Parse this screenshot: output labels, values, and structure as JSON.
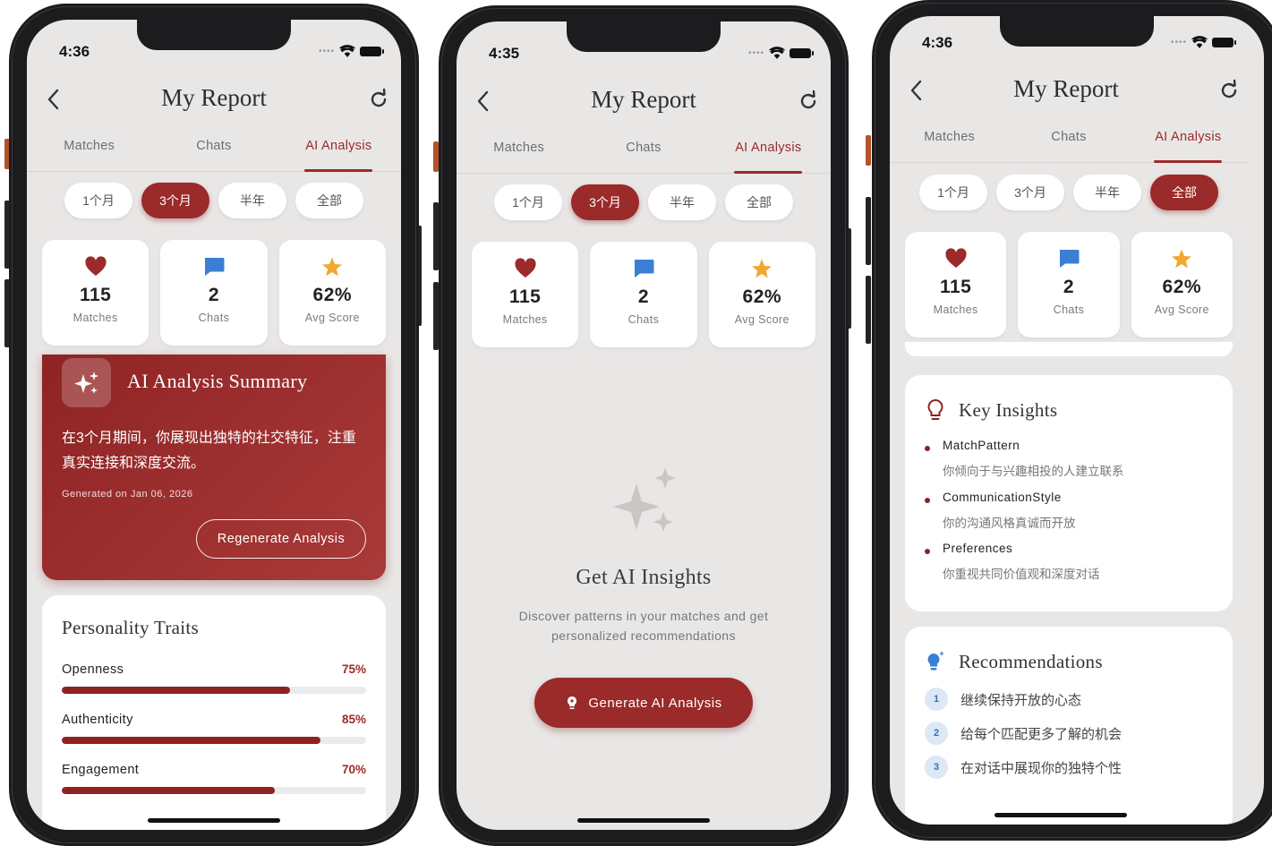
{
  "phones": [
    {
      "time": "4:36",
      "title": "My Report",
      "tabs": [
        "Matches",
        "Chats",
        "AI Analysis"
      ],
      "periods": [
        "1个月",
        "3个月",
        "半年",
        "全部"
      ],
      "stats": [
        {
          "value": "115",
          "label": "Matches",
          "icon": "heart-icon"
        },
        {
          "value": "2",
          "label": "Chats",
          "icon": "chat-bubble-icon"
        },
        {
          "value": "62%",
          "label": "Avg Score",
          "icon": "star-icon"
        }
      ],
      "summary": {
        "title": "AI Analysis Summary",
        "text": "在3个月期间，你展现出独特的社交特征，注重真实连接和深度交流。",
        "generated": "Generated on Jan 06, 2026",
        "button": "Regenerate Analysis"
      },
      "traits": {
        "title": "Personality Traits",
        "items": [
          {
            "name": "Openness",
            "percent": "75%",
            "value": 0.75
          },
          {
            "name": "Authenticity",
            "percent": "85%",
            "value": 0.85
          },
          {
            "name": "Engagement",
            "percent": "70%",
            "value": 0.7
          }
        ]
      }
    },
    {
      "time": "4:35",
      "title": "My Report",
      "tabs": [
        "Matches",
        "Chats",
        "AI Analysis"
      ],
      "periods": [
        "1个月",
        "3个月",
        "半年",
        "全部"
      ],
      "stats": [
        {
          "value": "115",
          "label": "Matches",
          "icon": "heart-icon"
        },
        {
          "value": "2",
          "label": "Chats",
          "icon": "chat-bubble-icon"
        },
        {
          "value": "62%",
          "label": "Avg Score",
          "icon": "star-icon"
        }
      ],
      "empty": {
        "title": "Get AI Insights",
        "description": "Discover patterns in your matches and get personalized recommendations",
        "button": "Generate AI Analysis"
      }
    },
    {
      "time": "4:36",
      "title": "My Report",
      "tabs": [
        "Matches",
        "Chats",
        "AI Analysis"
      ],
      "periods": [
        "1个月",
        "3个月",
        "半年",
        "全部"
      ],
      "stats": [
        {
          "value": "115",
          "label": "Matches",
          "icon": "heart-icon"
        },
        {
          "value": "2",
          "label": "Chats",
          "icon": "chat-bubble-icon"
        },
        {
          "value": "62%",
          "label": "Avg Score",
          "icon": "star-icon"
        }
      ],
      "insights": {
        "title": "Key Insights",
        "items": [
          {
            "title": "MatchPattern",
            "desc": "你倾向于与兴趣相投的人建立联系"
          },
          {
            "title": "CommunicationStyle",
            "desc": "你的沟通风格真诚而开放"
          },
          {
            "title": "Preferences",
            "desc": "你重视共同价值观和深度对话"
          }
        ]
      },
      "recommendations": {
        "title": "Recommendations",
        "items": [
          {
            "num": "1",
            "text": "继续保持开放的心态"
          },
          {
            "num": "2",
            "text": "给每个匹配更多了解的机会"
          },
          {
            "num": "3",
            "text": "在对话中展现你的独特个性"
          }
        ]
      }
    }
  ],
  "colors": {
    "accent": "#9b2a2a",
    "background": "#e9e7e6",
    "star": "#f0a830",
    "chat": "#3a7fd5"
  }
}
